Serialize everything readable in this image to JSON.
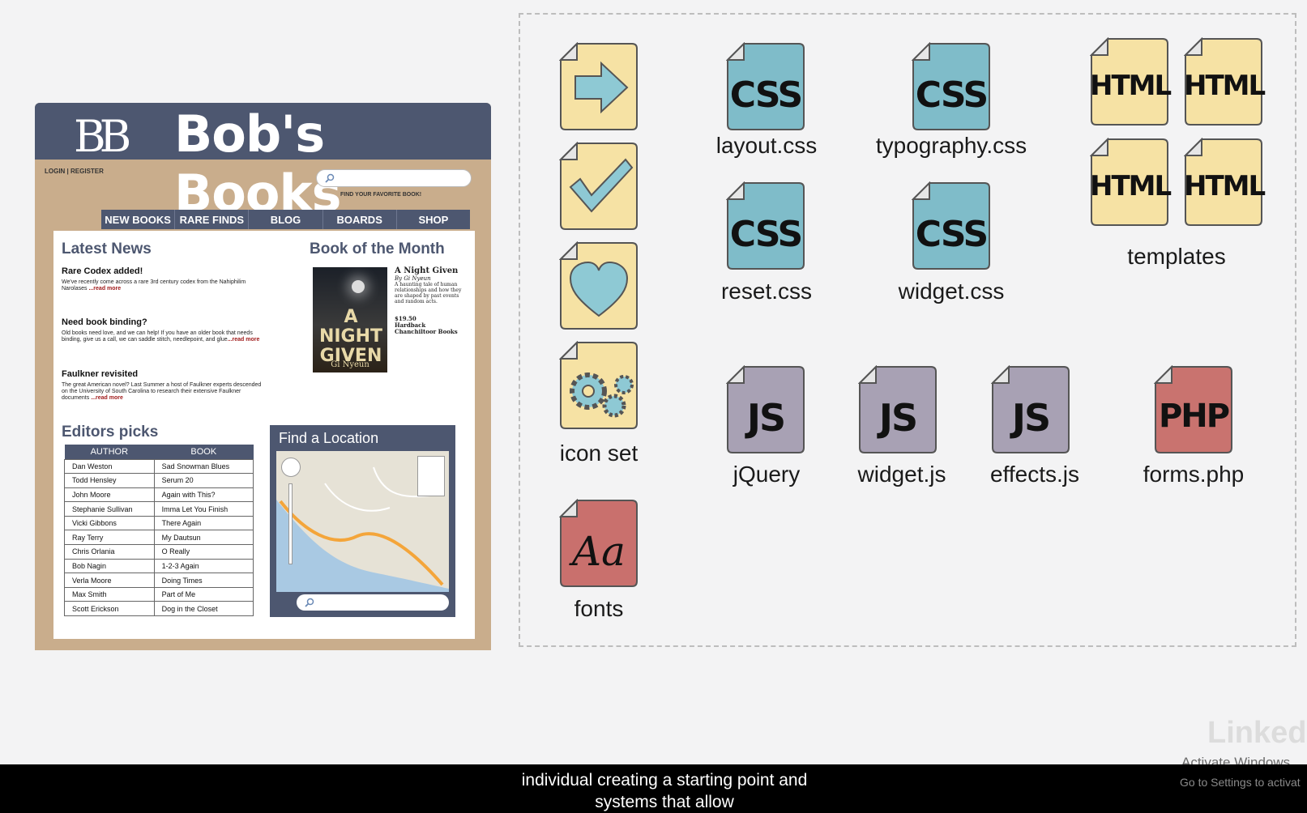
{
  "site": {
    "logo": "BB",
    "title": "Bob's Books",
    "login": "LOGIN | REGISTER",
    "search_hint": "FIND YOUR FAVORITE BOOK!",
    "nav": [
      "NEW BOOKS",
      "RARE FINDS",
      "BLOG",
      "BOARDS",
      "SHOP"
    ],
    "news_heading": "Latest News",
    "news": [
      {
        "title": "Rare Codex added!",
        "body": "We've recently come across a rare 3rd century codex from the Nahiphilim Narolases",
        "more": "...read more"
      },
      {
        "title": "Need book binding?",
        "body": "Old books need love, and we can help! If you have an older book that needs binding, give us a call, we can saddle stitch, needlepoint, and glue",
        "more": "...read more"
      },
      {
        "title": "Faulkner revisited",
        "body": "The great American novel? Last Summer a host of Faulkner experts descended on the University of South Carolina to research their extensive Faulkner documents",
        "more": "...read more"
      }
    ],
    "botm_heading": "Book of the Month",
    "book": {
      "cover_title": "A NIGHT GIVEN",
      "cover_author": "Gi Nyeun",
      "title": "A Night Given",
      "by": "By Gi Nyeun",
      "desc": "A haunting tale of human relationships and how they are shaped by past events and random acts.",
      "price": "$19.50",
      "format": "Hardback",
      "publisher": "Chanchiltoor Books"
    },
    "picks_heading": "Editors picks",
    "picks_columns": [
      "AUTHOR",
      "BOOK"
    ],
    "picks": [
      [
        "Dan Weston",
        "Sad Snowman Blues"
      ],
      [
        "Todd Hensley",
        "Serum 20"
      ],
      [
        "John Moore",
        "Again with This?"
      ],
      [
        "Stephanie Sullivan",
        "Imma Let You Finish"
      ],
      [
        "Vicki Gibbons",
        "There Again"
      ],
      [
        "Ray Terry",
        "My Dautsun"
      ],
      [
        "Chris Orlania",
        "O Really"
      ],
      [
        "Bob Nagin",
        "1-2-3 Again"
      ],
      [
        "Verla Moore",
        "Doing Times"
      ],
      [
        "Max Smith",
        "Part of Me"
      ],
      [
        "Scott Erickson",
        "Dog in the Closet"
      ]
    ],
    "location_heading": "Find a Location"
  },
  "assets": {
    "icon_set": "icon set",
    "fonts": "fonts",
    "fonts_glyph": "Aa",
    "css_glyph": "CSS",
    "html_glyph": "HTML",
    "js_glyph": "JS",
    "php_glyph": "PHP",
    "layout_css": "layout.css",
    "typography_css": "typography.css",
    "reset_css": "reset.css",
    "widget_css": "widget.css",
    "templates": "templates",
    "jquery": "jQuery",
    "widget_js": "widget.js",
    "effects_js": "effects.js",
    "forms_php": "forms.php"
  },
  "colors": {
    "icon_yellow": "#f6e2a4",
    "css_blue": "#7fbcc9",
    "js_purple": "#a8a1b4",
    "php_red": "#c9736f",
    "fonts_red": "#c9706d",
    "nav_slate": "#4d5770"
  },
  "caption": {
    "line1": "individual creating a starting point and",
    "line2": "systems that allow"
  },
  "watermark": {
    "linked": "Linked",
    "activate": "Activate Windows",
    "settings": "Go to Settings to activat"
  }
}
